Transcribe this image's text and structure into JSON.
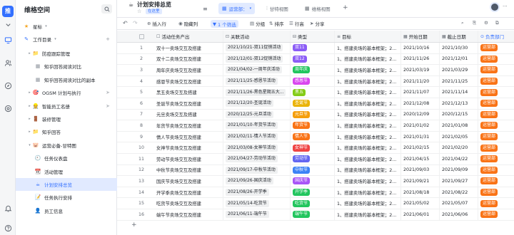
{
  "rail": {
    "logo": "推",
    "icons": [
      "chevron-down-icon",
      "monitor-icon",
      "users-icon",
      "compass-icon",
      "settings-icon",
      "bell-icon",
      "help-icon"
    ]
  },
  "sidebar": {
    "title": "维格空间",
    "starred_label": "星标",
    "workspace_label": "工作目录",
    "items": [
      {
        "label": "防疫跟踪管理",
        "icon": "📁",
        "level": 1,
        "caret": "▸"
      },
      {
        "label": "知乎回答阅读对比",
        "icon": "▦",
        "level": 2,
        "caret": ""
      },
      {
        "label": "知乎回答阅读对比的副本",
        "icon": "▦",
        "level": 2,
        "caret": ""
      },
      {
        "label": "OGSM 计划与执行",
        "icon": "🎯",
        "level": 1,
        "caret": "▸"
      },
      {
        "label": "智能员工名册",
        "icon": "👷",
        "level": 1,
        "caret": "▸"
      },
      {
        "label": "装修管理",
        "icon": "🚪",
        "level": 1,
        "caret": "▸"
      },
      {
        "label": "知乎回答",
        "icon": "📁",
        "level": 1,
        "caret": "▸"
      },
      {
        "label": "运营必备-甘特图",
        "icon": "🐷",
        "level": 1,
        "caret": "▾"
      },
      {
        "label": "任务仪表盘",
        "icon": "🕘",
        "level": 2,
        "caret": ""
      },
      {
        "label": "活动管理",
        "icon": "📆",
        "level": 2,
        "caret": ""
      },
      {
        "label": "计划安排总览",
        "icon": "☕",
        "level": 2,
        "caret": "",
        "active": true
      },
      {
        "label": "任务执行安排",
        "icon": "📝",
        "level": 2,
        "caret": ""
      },
      {
        "label": "员工信息",
        "icon": "👤",
        "level": 2,
        "caret": ""
      }
    ]
  },
  "header": {
    "title": "计划安排总览",
    "tag": "在这里",
    "tabs": [
      {
        "label": "运营部：",
        "icon": "▦",
        "active": true
      },
      {
        "label": "甘特视图",
        "icon": "⫶",
        "active": false
      },
      {
        "label": "维格视图",
        "icon": "▦",
        "active": false
      }
    ]
  },
  "toolbar": {
    "insert": "插入行",
    "hide": "隐藏列",
    "filter": "1 个筛选",
    "group": "分组",
    "sort": "排序",
    "row_height": "行高",
    "share": "分享"
  },
  "table": {
    "columns": {
      "name": "活动任务产出",
      "rel": "关联活动",
      "type": "类型",
      "goal": "目标",
      "start": "开始日期",
      "end": "截止日期",
      "dept": "负责部门"
    },
    "rows": [
      {
        "n": "1",
        "name": "双十一卖场交互及搭建",
        "rel": "2021/10/21-双11促销活动",
        "type": "双11",
        "type_color": "#8b5cf6",
        "goal": "1、搭建卖场的基本框架；2...",
        "start": "2021/10/16",
        "end": "2021/10/30",
        "dept": "运营部"
      },
      {
        "n": "2",
        "name": "双十二卖场交互及搭建",
        "rel": "2021/12/01-双12促销活动",
        "type": "双12",
        "type_color": "#8b5cf6",
        "goal": "1、搭建卖场的基本框架；2...",
        "start": "2021/11/26",
        "end": "2021/12/01",
        "dept": "运营部"
      },
      {
        "n": "3",
        "name": "周年庆卖场交互及搭建",
        "rel": "2021/04/02-一周年庆活动",
        "type": "周年庆",
        "type_color": "#22c55e",
        "goal": "1、搭建卖场的基本框架；2...",
        "start": "2021/03/19",
        "end": "2021/03/29",
        "dept": "运营部"
      },
      {
        "n": "4",
        "name": "感恩节卖场交互及搭建",
        "rel": "2021/11/25-感恩节活动",
        "type": "感恩节",
        "type_color": "#d946ef",
        "goal": "1、搭建卖场的基本框架；2...",
        "start": "2021/11/20",
        "end": "2021/11/25",
        "dept": "运营部"
      },
      {
        "n": "5",
        "name": "黑五卖场交互及搭建",
        "rel": "2021/11/26-黑色星期五大...",
        "type": "黑五",
        "type_color": "#84cc16",
        "goal": "1、搭建卖场的基本框架；2...",
        "start": "2021/11/07",
        "end": "2021/11/14",
        "dept": "运营部"
      },
      {
        "n": "6",
        "name": "圣诞节卖场交互及搭建",
        "rel": "2021/12/20-圣诞活动",
        "type": "圣诞节",
        "type_color": "#eab308",
        "goal": "1、搭建卖场的基本框架；2...",
        "start": "2021/12/08",
        "end": "2021/12/13",
        "dept": "运营部"
      },
      {
        "n": "7",
        "name": "元旦卖场交互及搭建",
        "rel": "2020/12/25-元旦活动",
        "type": "元旦节",
        "type_color": "#f59e0b",
        "goal": "1、搭建卖场的基本框架；2...",
        "start": "2020/12/09",
        "end": "2020/12/15",
        "dept": "运营部"
      },
      {
        "n": "8",
        "name": "年货节卖场交互及搭建",
        "rel": "2021/01/10-年货节活动",
        "type": "年货节",
        "type_color": "#f97316",
        "goal": "1、搭建卖场的基本框架；2...",
        "start": "2021/01/02",
        "end": "2021/01/08",
        "dept": "运营部"
      },
      {
        "n": "9",
        "name": "情人节卖场交互及搭建",
        "rel": "2021/02/11-情人节活动",
        "type": "情人节",
        "type_color": "#f97316",
        "goal": "1、搭建卖场的基本框架；2...",
        "start": "2021/01/31",
        "end": "2021/02/05",
        "dept": "运营部"
      },
      {
        "n": "10",
        "name": "女神节卖场交互及搭建",
        "rel": "2021/03/08-女神节活动",
        "type": "女神节",
        "type_color": "#ef4444",
        "goal": "1、搭建卖场的基本框架；2...",
        "start": "2021/02/15",
        "end": "2021/02/20",
        "dept": "运营部"
      },
      {
        "n": "11",
        "name": "劳动节卖场交互及搭建",
        "rel": "2021/04/27-劳动节活动",
        "type": "劳动节",
        "type_color": "#6366f1",
        "goal": "1、搭建卖场的基本框架；2...",
        "start": "2021/04/15",
        "end": "2021/04/22",
        "dept": "运营部"
      },
      {
        "n": "12",
        "name": "中秋节卖场交互及搭建",
        "rel": "2021/09/17-中秋节活动",
        "type": "中秋节",
        "type_color": "#3b82f6",
        "goal": "1、搭建卖场的基本框架；2...",
        "start": "2021/09/03",
        "end": "2021/09/09",
        "dept": "运营部"
      },
      {
        "n": "13",
        "name": "国庆节卖场交互及搭建",
        "rel": "2021/09/26-国庆活动",
        "type": "国庆节",
        "type_color": "#a855f7",
        "goal": "1、搭建卖场的基本框架；2...",
        "start": "2021/09/21",
        "end": "2021/09/27",
        "dept": "运营部"
      },
      {
        "n": "14",
        "name": "开学季卖场交互及搭建",
        "rel": "2021/08/26-开学季",
        "type": "开学季",
        "type_color": "#22c55e",
        "goal": "1、搭建卖场的基本框架；2...",
        "start": "2021/08/18",
        "end": "2021/08/22",
        "dept": "运营部"
      },
      {
        "n": "15",
        "name": "吃货节卖场交互及搭建",
        "rel": "2021/05/14-吃货节",
        "type": "吃货节",
        "type_color": "#22c55e",
        "goal": "1、搭建卖场的基本框架；2...",
        "start": "2021/05/02",
        "end": "2021/05/07",
        "dept": "运营部"
      },
      {
        "n": "16",
        "name": "端午节卖场交互及搭建",
        "rel": "2021/06/11-端午节",
        "type": "端午节",
        "type_color": "#22c55e",
        "goal": "1、搭建卖场的基本框架；2...",
        "start": "2021/06/01",
        "end": "2021/06/06",
        "dept": "运营部"
      }
    ],
    "add_row": "+"
  }
}
